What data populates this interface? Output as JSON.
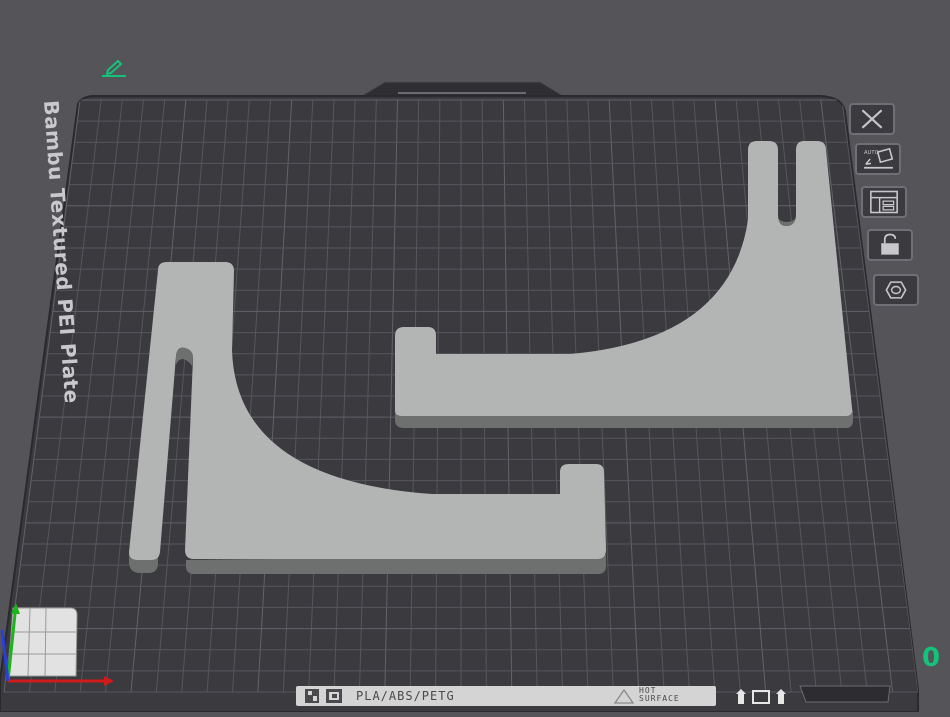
{
  "plate": {
    "name": "Bambu Textured PEI Plate",
    "index": "0",
    "filament_label": "PLA/ABS/PETG",
    "hot_surface_label_line1": "HOT",
    "hot_surface_label_line2": "SURFACE"
  },
  "toolbar": {
    "items": [
      {
        "name": "close-plate",
        "icon": "x-icon"
      },
      {
        "name": "auto-orient",
        "icon": "auto-orient-icon"
      },
      {
        "name": "arrange",
        "icon": "arrange-icon"
      },
      {
        "name": "lock-plate",
        "icon": "lock-icon"
      },
      {
        "name": "plate-settings",
        "icon": "hexagon-settings-icon"
      }
    ]
  },
  "colors": {
    "background": "#545459",
    "plate": "#3a3a3f",
    "grid": "#5a5a60",
    "model": "#b3b5b4",
    "model_side": "#6e706f",
    "accent": "#14c27a",
    "axis_x": "#d01b1b",
    "axis_y": "#1bb51b",
    "axis_z": "#2a3ee0"
  }
}
